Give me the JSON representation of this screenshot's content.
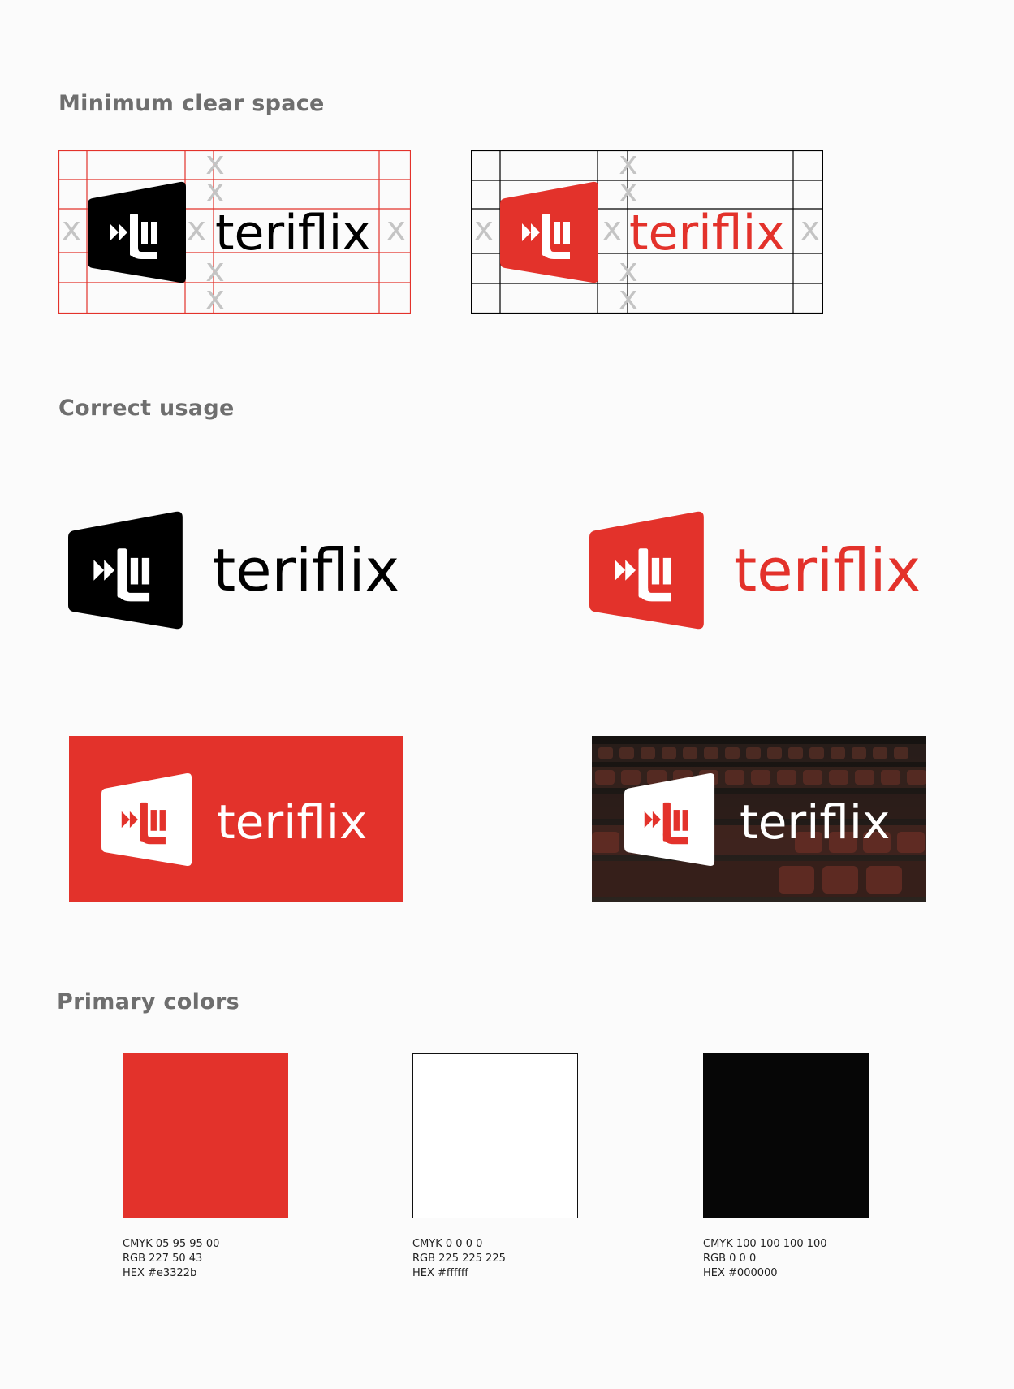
{
  "sections": {
    "clear_space_title": "Minimum clear space",
    "correct_usage_title": "Correct usage",
    "primary_colors_title": "Primary colors"
  },
  "brand": {
    "wordmark": "teriflix",
    "clear_space_marker": "x",
    "red": "#e3322b",
    "black": "#000000",
    "white": "#ffffff"
  },
  "clear_space_panels": [
    {
      "variant": "black-logo-red-grid",
      "grid_color": "#e3322b",
      "logo_color": "#000000"
    },
    {
      "variant": "red-logo-black-grid",
      "grid_color": "#000000",
      "logo_color": "#e3322b"
    }
  ],
  "correct_usage": [
    {
      "variant": "black-on-white",
      "background": "#fbfbfb",
      "logo_color": "#000000"
    },
    {
      "variant": "red-on-white",
      "background": "#fbfbfb",
      "logo_color": "#e3322b"
    },
    {
      "variant": "white-on-red",
      "background": "#e3322b",
      "logo_color": "#ffffff"
    },
    {
      "variant": "white-on-photo",
      "background": "cinema seats photo",
      "logo_color": "#ffffff"
    }
  ],
  "primary_colors": [
    {
      "hex": "#e3322b",
      "cmyk": "CMYK 05 95 95 00",
      "rgb": "RGB 227 50 43",
      "hex_label": "HEX #e3322b"
    },
    {
      "hex": "#ffffff",
      "cmyk": "CMYK 0 0 0 0",
      "rgb": "RGB 225 225 225",
      "hex_label": "HEX #ffffff"
    },
    {
      "hex": "#000000",
      "cmyk": "CMYK 100 100 100 100",
      "rgb": "RGB 0 0 0",
      "hex_label": "HEX #000000"
    }
  ]
}
